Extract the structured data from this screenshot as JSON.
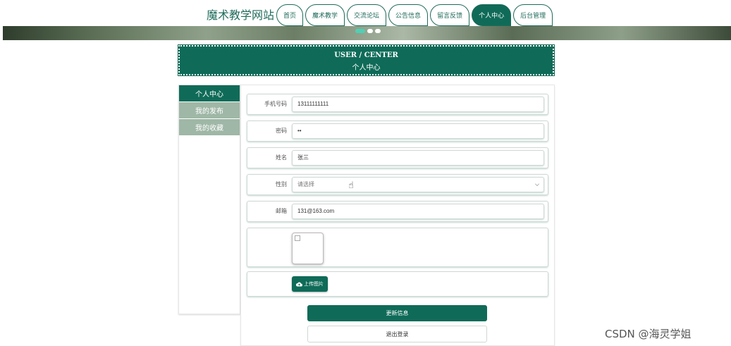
{
  "header": {
    "site_title": "魔术教学网站",
    "nav": [
      {
        "label": "首页",
        "active": false
      },
      {
        "label": "魔术教学",
        "active": false
      },
      {
        "label": "交流论坛",
        "active": false
      },
      {
        "label": "公告信息",
        "active": false
      },
      {
        "label": "留言反馈",
        "active": false
      },
      {
        "label": "个人中心",
        "active": true
      },
      {
        "label": "后台管理",
        "active": false
      }
    ]
  },
  "banner": {
    "slides": 3,
    "active_slide": 0
  },
  "title_box": {
    "english": "USER / CENTER",
    "chinese": "个人中心"
  },
  "sidebar": {
    "items": [
      {
        "label": "个人中心",
        "active": true
      },
      {
        "label": "我的发布",
        "active": false
      },
      {
        "label": "我的收藏",
        "active": false
      }
    ]
  },
  "form": {
    "phone": {
      "label": "手机号码",
      "value": "13111111111"
    },
    "password": {
      "label": "密码",
      "value": "••"
    },
    "name": {
      "label": "姓名",
      "value": "张三"
    },
    "gender": {
      "label": "性别",
      "placeholder": "请选择"
    },
    "email": {
      "label": "邮箱",
      "value": "131@163.com"
    },
    "upload_label": "上传图片",
    "update_label": "更新信息",
    "logout_label": "退出登录"
  },
  "watermark": "CSDN @海灵学姐",
  "colors": {
    "primary": "#0f6b58",
    "sidebar_inactive": "#9fb7a6",
    "dot_active": "#4fd0b5"
  }
}
